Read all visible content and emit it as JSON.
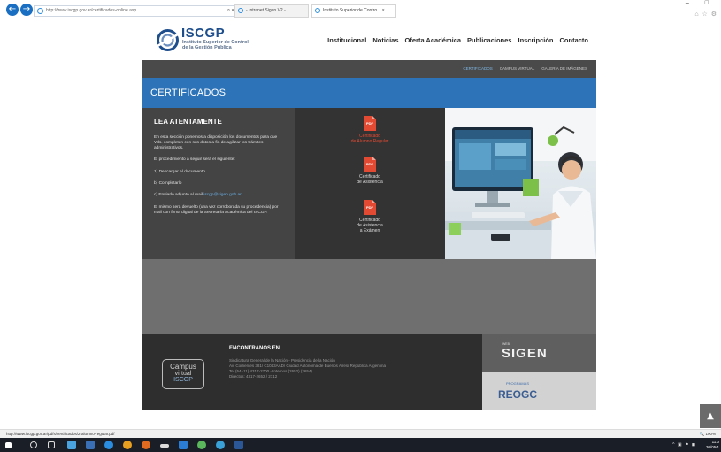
{
  "browser": {
    "url": "http://www.iscgp.gov.ar/certificados-online.asp",
    "search_tools": "⌕ ▾ ↻",
    "tabs": [
      {
        "label": "- Intranet Sigen V2 -"
      },
      {
        "label": "Instituto Superior de Contro...",
        "close": "×"
      }
    ],
    "window_controls": "– □",
    "toolbar_icons": "⌂ ☆ ⚙",
    "status_url": "http://www.iscgp.gov.ar/pdfs/certificados/2-alumno-regular.pdf",
    "zoom": "🔍 100%"
  },
  "site": {
    "logo": {
      "title": "ISCGP",
      "subtitle_line1": "Instituto Superior de Control",
      "subtitle_line2": "de la Gestión Pública"
    },
    "main_nav": [
      "Institucional",
      "Noticias",
      "Oferta Académica",
      "Publicaciones",
      "Inscripción",
      "Contacto"
    ],
    "sub_nav": [
      "CERTIFICADOS",
      "CAMPUS VIRTUAL",
      "GALERÍA DE IMÁGENES"
    ],
    "page_title": "CERTIFICADOS",
    "notice": {
      "heading": "LEA ATENTAMENTE",
      "p1": "En esta sección ponemos a disposición los documentos para que Vds. completen con sus datos a fin de agilizar los trámites administrativos.",
      "p2": "El procedimiento a seguir será el siguiente:",
      "p3": "1) Descargar el documento",
      "p4": "b) Completarlo",
      "p5_prefix": "c) Enviarlo adjunto al mail ",
      "p5_email": "iscgp@sigen.gob.ar",
      "p6": "El mismo será devuelto (una vez corroborada su procedencia) por mail con firma digital de la Secretaría Académica del ISCGP."
    },
    "documents": [
      {
        "icon": "PDF",
        "label": "Certificado\nde Alumno Regular"
      },
      {
        "icon": "PDF",
        "label": "Certificado\nde Asistencia"
      },
      {
        "icon": "PDF",
        "label": "Certificado\nde Asistencia\na Exámen"
      }
    ],
    "footer": {
      "heading": "ENCONTRANOS EN",
      "line1": "Sindicatura General de la Nación - Presidencia de la Nación",
      "line2": "Av. Corrientes 381/ C1043AAD/ Ciudad Autónoma de Buenos Aires/ República Argentina",
      "line3": "Tel.(54+11) 4317-2700 - Internos (2652) (2654)",
      "line4": "Directos: 4317-2652 / 2712",
      "campus_line1": "Campus",
      "campus_line2": "virtual",
      "campus_line3": "ISCGP",
      "sigen_small": "WEB",
      "sigen": "SIGEN",
      "reogc_small": "PROGRAMAS",
      "reogc": "REOGC"
    }
  },
  "scroll_top": "▲",
  "taskbar": {
    "time": "11:0",
    "date": "30/05/1",
    "tray": "^ ▣ ⚑ ◼"
  },
  "colors": {
    "brand_blue": "#2d73b8",
    "pdf_red": "#e34a33",
    "link_blue": "#6ab0e6"
  }
}
